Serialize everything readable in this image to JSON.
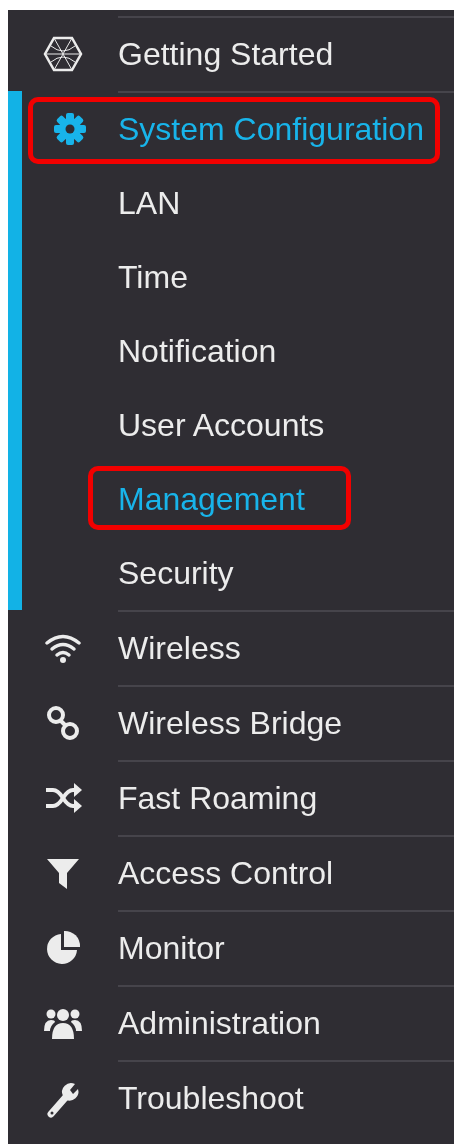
{
  "menu": [
    {
      "label": "Getting Started",
      "selected": false,
      "expanded": false,
      "highlighted": false
    },
    {
      "label": "System Configuration",
      "selected": true,
      "expanded": true,
      "highlighted": true,
      "children": [
        {
          "label": "LAN",
          "selected": false,
          "highlighted": false
        },
        {
          "label": "Time",
          "selected": false,
          "highlighted": false
        },
        {
          "label": "Notification",
          "selected": false,
          "highlighted": false
        },
        {
          "label": "User Accounts",
          "selected": false,
          "highlighted": false
        },
        {
          "label": "Management",
          "selected": true,
          "highlighted": true
        },
        {
          "label": "Security",
          "selected": false,
          "highlighted": false
        }
      ]
    },
    {
      "label": "Wireless",
      "selected": false,
      "expanded": false,
      "highlighted": false
    },
    {
      "label": "Wireless Bridge",
      "selected": false,
      "expanded": false,
      "highlighted": false
    },
    {
      "label": "Fast Roaming",
      "selected": false,
      "expanded": false,
      "highlighted": false
    },
    {
      "label": "Access Control",
      "selected": false,
      "expanded": false,
      "highlighted": false
    },
    {
      "label": "Monitor",
      "selected": false,
      "expanded": false,
      "highlighted": false
    },
    {
      "label": "Administration",
      "selected": false,
      "expanded": false,
      "highlighted": false
    },
    {
      "label": "Troubleshoot",
      "selected": false,
      "expanded": false,
      "highlighted": false
    }
  ]
}
